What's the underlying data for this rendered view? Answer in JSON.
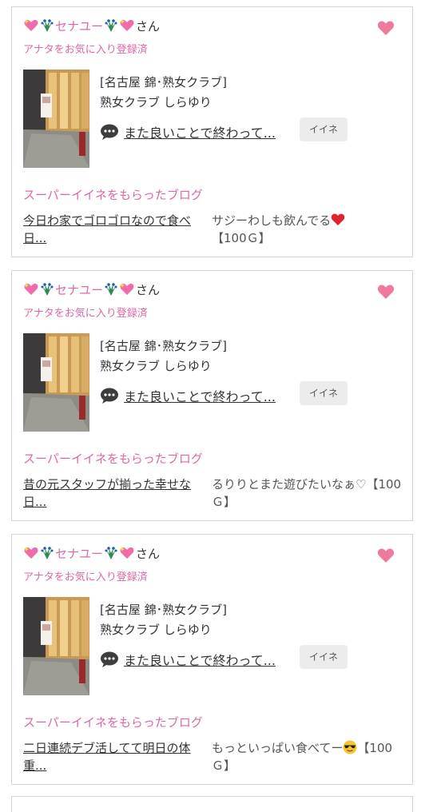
{
  "colors": {
    "pink": "#e066a8",
    "heart": "#f07a9c",
    "card_border": "#d4d4d4",
    "iine_bg": "#ececec"
  },
  "cards": [
    {
      "user_name": "セナユー",
      "honorific": "さん",
      "registered": "アナタをお気に入り登録済",
      "club": "[名古屋 錦･熟女クラブ]",
      "club_name": "熟女クラブ しらゆり",
      "comment": "また良いことで終わって...",
      "iine_label": "イイネ",
      "super_label": "スーパーイイネをもらったブログ",
      "blog_title": "今日わ家でゴロゴロなので食べ日...",
      "blog_comment_pre": "サジーわしも飲んでる",
      "blog_emoji": "red-heart-emoji",
      "blog_comment_post": "【100Ｇ】"
    },
    {
      "user_name": "セナユー",
      "honorific": "さん",
      "registered": "アナタをお気に入り登録済",
      "club": "[名古屋 錦･熟女クラブ]",
      "club_name": "熟女クラブ しらゆり",
      "comment": "また良いことで終わって...",
      "iine_label": "イイネ",
      "super_label": "スーパーイイネをもらったブログ",
      "blog_title": "昔の元スタッフが揃った幸せな日...",
      "blog_comment_pre": "るりりとまた遊びたいなぁ♡",
      "blog_emoji": "",
      "blog_comment_post": "【100Ｇ】"
    },
    {
      "user_name": "セナユー",
      "honorific": "さん",
      "registered": "アナタをお気に入り登録済",
      "club": "[名古屋 錦･熟女クラブ]",
      "club_name": "熟女クラブ しらゆり",
      "comment": "また良いことで終わって...",
      "iine_label": "イイネ",
      "super_label": "スーパーイイネをもらったブログ",
      "blog_title": "二日連続デブ活してて明日の体重...",
      "blog_comment_pre": "もっといっぱい食べてー",
      "blog_emoji": "sunglasses-emoji",
      "blog_comment_post": "【100Ｇ】"
    }
  ]
}
